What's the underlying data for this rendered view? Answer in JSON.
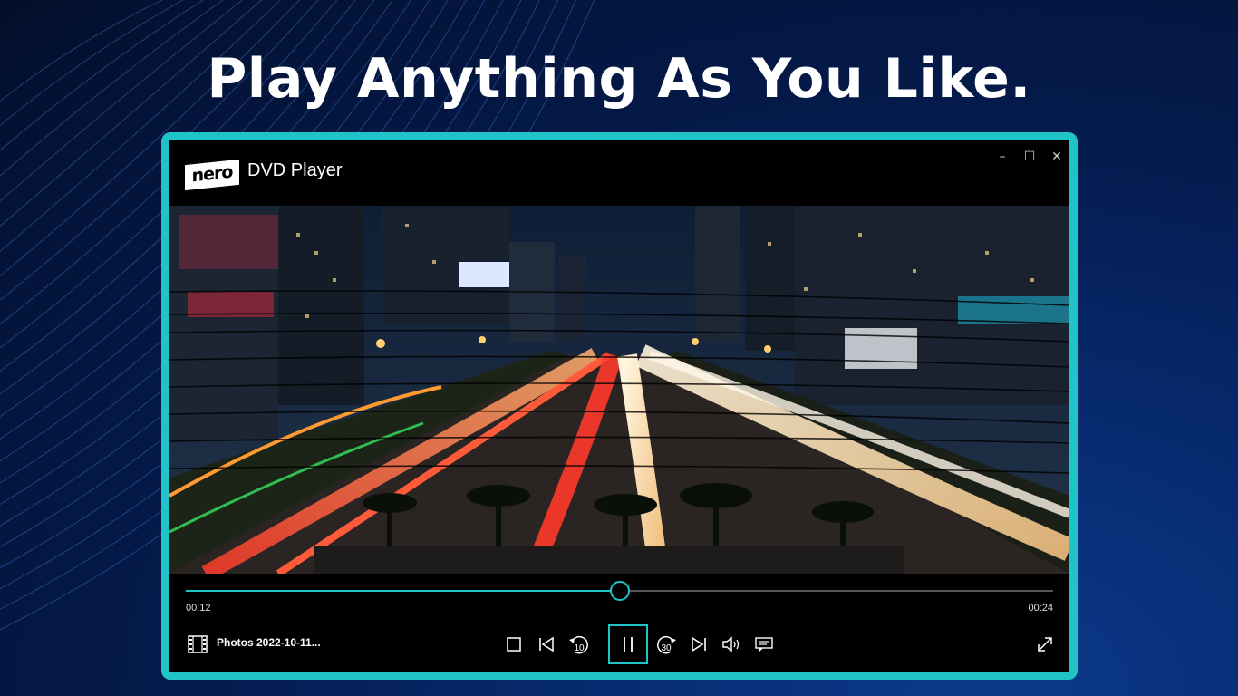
{
  "headline": "Play Anything As You Like.",
  "app": {
    "logo_text": "nero",
    "title": "DVD Player",
    "minimize_label": "–",
    "maximize_label": "☐",
    "close_label": "✕"
  },
  "player": {
    "current_time": "00:12",
    "total_time": "00:24",
    "progress": 0.5,
    "file_name": "Photos 2022-10-11..."
  },
  "colors": {
    "accent": "#20c4c8",
    "background": "#041a4a"
  },
  "controls": {
    "stop_icon": "stop-icon",
    "previous_icon": "skip-previous-icon",
    "rewind_label": "10",
    "pause_icon": "pause-icon",
    "forward_label": "30",
    "next_icon": "skip-next-icon",
    "volume_icon": "volume-icon",
    "subtitles_icon": "subtitles-icon",
    "fullscreen_icon": "fullscreen-icon"
  }
}
